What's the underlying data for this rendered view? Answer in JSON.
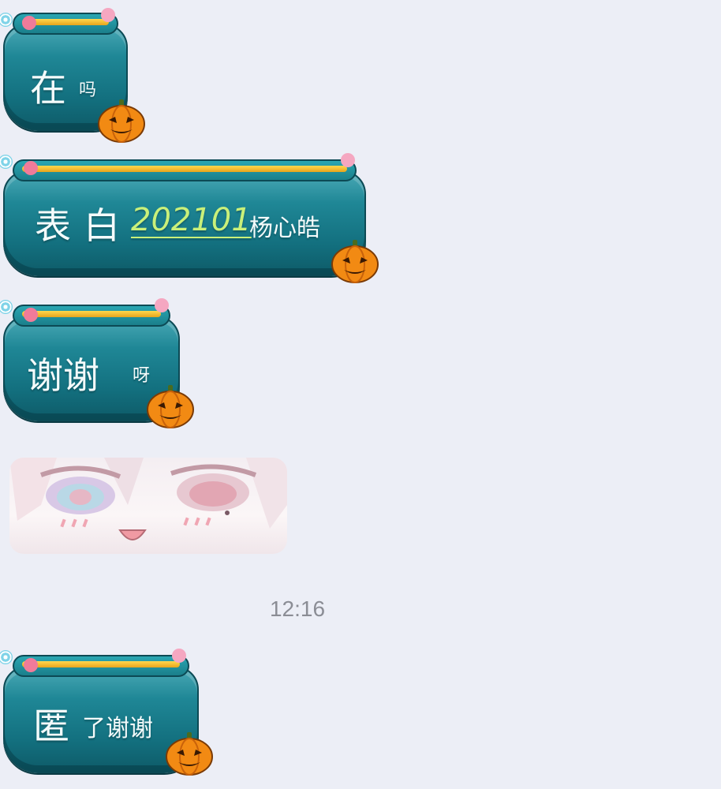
{
  "messages": [
    {
      "main": "在",
      "tail": "吗"
    },
    {
      "main": "表白",
      "highlight": "202101",
      "tail": "杨心皓"
    },
    {
      "main": "谢谢",
      "tail": "呀"
    },
    {
      "type": "sticker",
      "icon": "anime-girl-face-sticker"
    },
    {
      "main": "匿",
      "tail": "了谢谢"
    }
  ],
  "timestamp": "12:16",
  "colors": {
    "background": "#eceef6",
    "bubble_teal": "#13707f",
    "rim_gold": "#ffd84d",
    "highlight_green": "#c9f07a",
    "timestamp_gray": "#8b8d95"
  }
}
